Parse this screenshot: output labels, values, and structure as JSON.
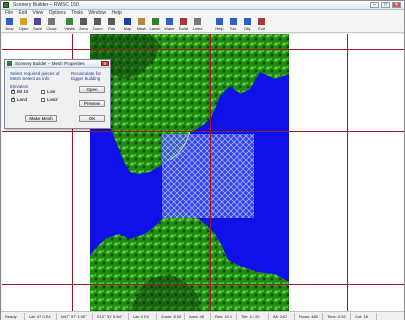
{
  "window": {
    "title": "Scenery Builder – RWSC 150"
  },
  "titlebar_controls": {
    "minimize": "–",
    "maximize": "□",
    "close": "✕"
  },
  "menu": [
    "File",
    "Edit",
    "View",
    "Options",
    "Tools",
    "Window",
    "Help"
  ],
  "toolbar": [
    {
      "label": "New",
      "icon": "new-icon",
      "color": "#2f5fbf"
    },
    {
      "label": "Open",
      "icon": "open-icon",
      "color": "#d6a12a"
    },
    {
      "label": "Save",
      "icon": "save-icon",
      "color": "#4a4a9a"
    },
    {
      "label": "Close",
      "icon": "close-file-icon",
      "color": "#777777"
    },
    {
      "label": "Views",
      "icon": "views-icon",
      "color": "#3a8a3a"
    },
    {
      "label": "Area",
      "icon": "area-icon",
      "color": "#5a5a5a"
    },
    {
      "label": "Zoom",
      "icon": "zoom-icon",
      "color": "#5a5a5a"
    },
    {
      "label": "Pan",
      "icon": "pan-icon",
      "color": "#5a5a5a"
    },
    {
      "label": "Map",
      "icon": "map-icon",
      "color": "#1f3fa8"
    },
    {
      "label": "Mesh",
      "icon": "mesh-icon",
      "color": "#b08a3a"
    },
    {
      "label": "Landc.",
      "icon": "landclass-icon",
      "color": "#2f7f2f"
    },
    {
      "label": "Water",
      "icon": "water-icon",
      "color": "#2f5fbf"
    },
    {
      "label": "Build",
      "icon": "build-icon",
      "color": "#a03a3a"
    },
    {
      "label": "Lines",
      "icon": "lines-icon",
      "color": "#777777"
    },
    {
      "label": "Help",
      "icon": "help-icon",
      "color": "#2f5fbf"
    },
    {
      "label": "Sel.",
      "icon": "select-icon",
      "color": "#2f5fbf"
    },
    {
      "label": "Obj.",
      "icon": "object-icon",
      "color": "#2f5fbf"
    },
    {
      "label": "Exit",
      "icon": "exit-icon",
      "color": "#a03a3a"
    }
  ],
  "dialog": {
    "title": "Scenery Builder – Mesh Properties",
    "close": "✕",
    "heading_line1": "Select required pieces of",
    "heading_line2": "Mesh Select as Info",
    "group_label": "Elevation",
    "options": [
      {
        "label": "Bit 16",
        "checked": true
      },
      {
        "label": "Low",
        "checked": false
      },
      {
        "label": "Land",
        "checked": true
      },
      {
        "label": "Low2",
        "checked": false
      }
    ],
    "right_text_line1": "Recalculate for",
    "right_text_line2": "bigger building",
    "btn_open": "Open",
    "btn_preview": "Preview",
    "btn_ok": "OK",
    "btn_make_mesh": "Make Mesh"
  },
  "status": [
    "Ready",
    "Lat: 47.0 E4",
    "N47° 57' 4.00\"",
    "E12° 31' 5.64\"",
    "Lat: 0 E0",
    "Zoom: 8.00",
    "Area: 45",
    "Res: 19.1",
    "Tile: 4 / 20",
    "Alt: 240",
    "Rows: 480",
    "Time: 0.52",
    "Cnt: 18"
  ],
  "colors": {
    "water": "#1010e8",
    "land_dark": "#0c3d08",
    "land_mid": "#1f8a14",
    "land_light": "#5fd23a",
    "grid_lines": "#9b1c1c",
    "selection": "#c8d4ff"
  }
}
